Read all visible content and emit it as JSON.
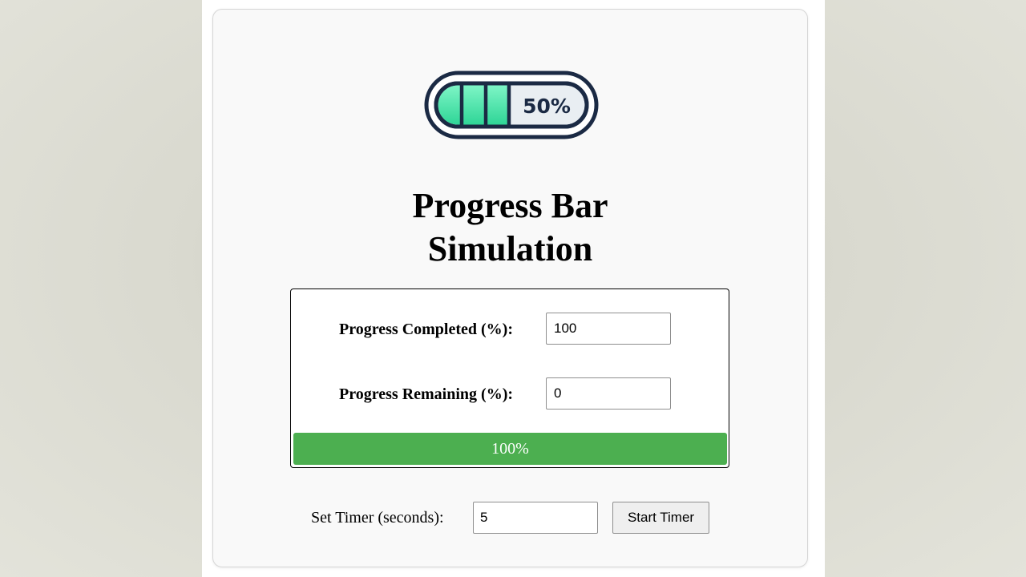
{
  "app": {
    "title": "Progress Bar Simulation"
  },
  "logo": {
    "icon": "battery-progress-icon",
    "text": "50%",
    "fill_fraction": 0.5,
    "colors": {
      "outline": "#1b2a44",
      "fill": "#3fe0a0",
      "empty": "#e9eef2"
    }
  },
  "progress": {
    "completed_label": "Progress Completed (%):",
    "completed_value": "100",
    "remaining_label": "Progress Remaining (%):",
    "remaining_value": "0",
    "percent": 100,
    "bar_text": "100%",
    "bar_color": "#4caf50"
  },
  "timer": {
    "label": "Set Timer (seconds):",
    "value": "5",
    "start_label": "Start Timer"
  }
}
